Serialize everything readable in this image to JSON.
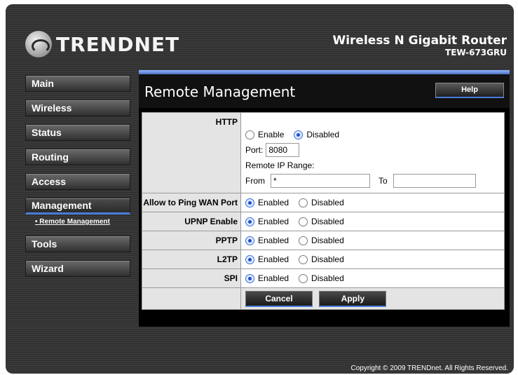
{
  "brand": {
    "name": "TRENDNET",
    "product_line": "Wireless N Gigabit Router",
    "model": "TEW-673GRU"
  },
  "nav": {
    "items": [
      {
        "label": "Main"
      },
      {
        "label": "Wireless"
      },
      {
        "label": "Status"
      },
      {
        "label": "Routing"
      },
      {
        "label": "Access"
      },
      {
        "label": "Management"
      },
      {
        "label": "Tools"
      },
      {
        "label": "Wizard"
      }
    ],
    "active": "Management",
    "sub_item": "Remote Management"
  },
  "page": {
    "title": "Remote Management",
    "help_label": "Help"
  },
  "http": {
    "label": "HTTP",
    "enable_label": "Enable",
    "disable_label": "Disabled",
    "selected": "Disabled",
    "port_label": "Port:",
    "port_value": "8080",
    "range_label": "Remote IP Range:",
    "from_label": "From",
    "from_value": "*",
    "to_label": "To",
    "to_value": ""
  },
  "options": [
    {
      "label": "Allow to Ping WAN Port",
      "enabled_label": "Enabled",
      "disabled_label": "Disabled",
      "selected": "Enabled"
    },
    {
      "label": "UPNP Enable",
      "enabled_label": "Enabled",
      "disabled_label": "Disabled",
      "selected": "Enabled"
    },
    {
      "label": "PPTP",
      "enabled_label": "Enabled",
      "disabled_label": "Disabled",
      "selected": "Enabled"
    },
    {
      "label": "L2TP",
      "enabled_label": "Enabled",
      "disabled_label": "Disabled",
      "selected": "Enabled"
    },
    {
      "label": "SPI",
      "enabled_label": "Enabled",
      "disabled_label": "Disabled",
      "selected": "Enabled"
    }
  ],
  "buttons": {
    "cancel": "Cancel",
    "apply": "Apply"
  },
  "footer": {
    "copyright": "Copyright © 2009 TRENDnet. All Rights Reserved."
  },
  "colors": {
    "accent": "#4a7ad8",
    "background": "#333333"
  }
}
